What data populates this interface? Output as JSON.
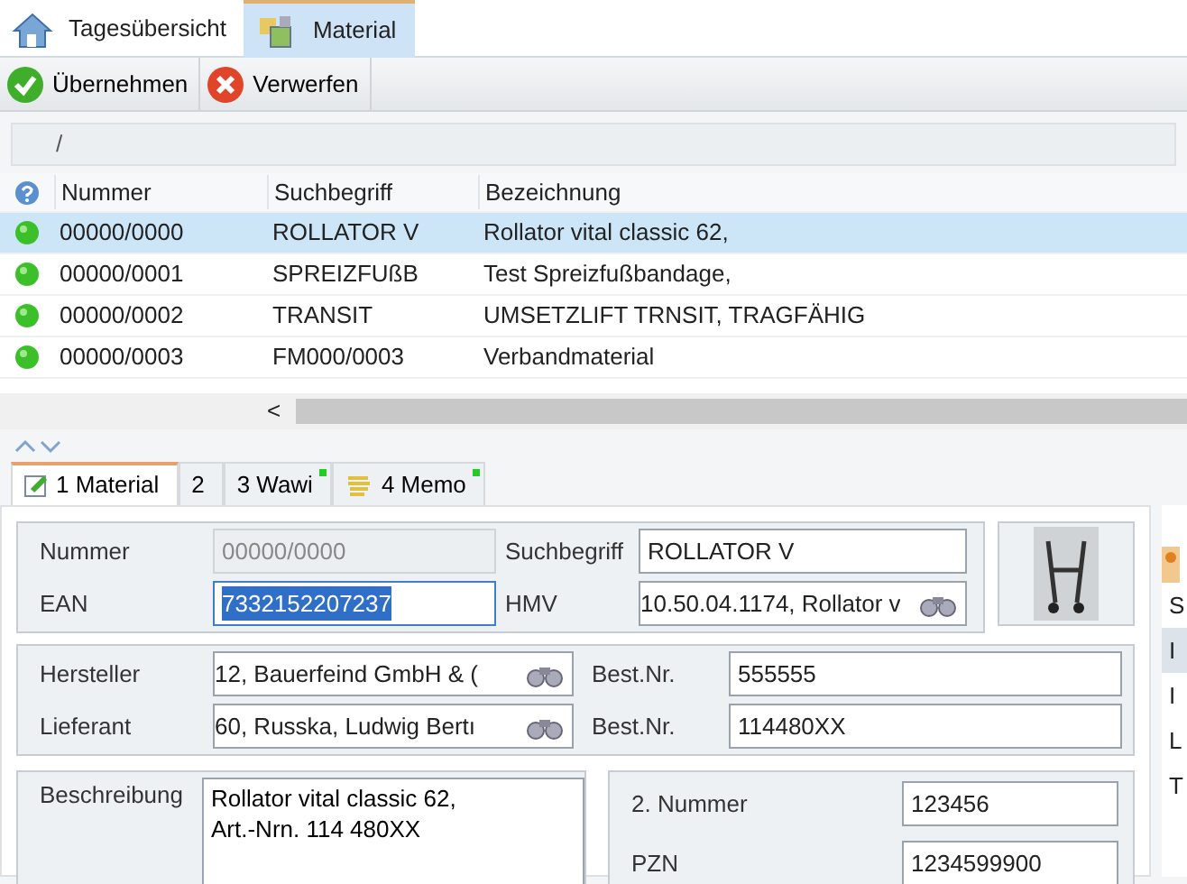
{
  "app_tabs": [
    {
      "label": "Tagesübersicht",
      "selected": false,
      "kind": "home"
    },
    {
      "label": "Material",
      "selected": true,
      "kind": "material"
    }
  ],
  "toolbar": [
    {
      "label": "Übernehmen",
      "kind": "accept"
    },
    {
      "label": "Verwerfen",
      "kind": "discard"
    }
  ],
  "path": "/",
  "table": {
    "columns": [
      "Nummer",
      "Suchbegriff",
      "Bezeichnung"
    ],
    "rows": [
      {
        "selected": true,
        "cells": [
          "00000/0000",
          "ROLLATOR V",
          "Rollator vital classic 62,"
        ]
      },
      {
        "selected": false,
        "cells": [
          "00000/0001",
          "SPREIZFUßB",
          "Test Spreizfußbandage,"
        ]
      },
      {
        "selected": false,
        "cells": [
          "00000/0002",
          "TRANSIT",
          "UMSETZLIFT TRNSIT, TRAGFÄHIG"
        ]
      },
      {
        "selected": false,
        "cells": [
          "00000/0003",
          "FM000/0003",
          "Verbandmaterial"
        ]
      }
    ],
    "scroll_left": "<"
  },
  "detail_tabs": [
    {
      "label": "1 Material",
      "selected": true,
      "modified": false,
      "kind": "edit"
    },
    {
      "label": "2",
      "selected": false,
      "modified": false,
      "kind": "plain"
    },
    {
      "label": "3 Wawi",
      "selected": false,
      "modified": true,
      "kind": "plain"
    },
    {
      "label": "4 Memo",
      "selected": false,
      "modified": true,
      "kind": "memo"
    }
  ],
  "group_1": [
    {
      "label": "Nummer",
      "value": "00000/0000",
      "kind": "readonly",
      "focused": false
    },
    {
      "label": "Suchbegriff",
      "value": "ROLLATOR V",
      "kind": "text",
      "focused": false
    },
    {
      "label": "EAN",
      "value": "7332152207237",
      "kind": "text",
      "focused": true
    },
    {
      "label": "HMV",
      "value": "10.50.04.1174, Rollator v",
      "kind": "lookup",
      "focused": false
    }
  ],
  "group_2": [
    {
      "label": "Hersteller",
      "value": "12, Bauerfeind GmbH & (",
      "kind": "lookup",
      "focused": false
    },
    {
      "label": "Best.Nr.",
      "value": "555555",
      "kind": "text",
      "focused": false
    },
    {
      "label": "Lieferant",
      "value": "60, Russka, Ludwig Bertı",
      "kind": "lookup",
      "focused": false
    },
    {
      "label": "Best.Nr.",
      "value": "114480XX",
      "kind": "text",
      "focused": false
    }
  ],
  "description": {
    "label": "Beschreibung",
    "value": "Rollator vital classic 62,\nArt.-Nrn. 114 480XX"
  },
  "group_3": [
    {
      "label": "2. Nummer",
      "value": "123456",
      "focused": false
    },
    {
      "label": "PZN",
      "value": "1234599900",
      "focused": false
    }
  ],
  "side_panel": [
    {
      "text": "S",
      "selected": false
    },
    {
      "text": "I",
      "selected": true
    },
    {
      "text": "I",
      "selected": false
    },
    {
      "text": "L",
      "selected": false
    },
    {
      "text": "T",
      "selected": false
    }
  ]
}
